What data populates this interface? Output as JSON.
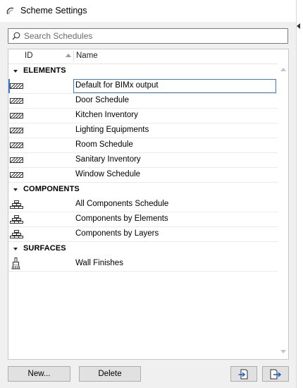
{
  "window": {
    "title": "Scheme Settings"
  },
  "search": {
    "placeholder": "Search Schedules"
  },
  "columns": {
    "id": "ID",
    "name": "Name"
  },
  "groups": [
    {
      "label": "ELEMENTS",
      "icon": "hatch-icon",
      "items": [
        {
          "id": "",
          "name": "Default for BIMx output",
          "selected": true
        },
        {
          "id": "",
          "name": "Door Schedule"
        },
        {
          "id": "",
          "name": "Kitchen Inventory"
        },
        {
          "id": "",
          "name": "Lighting Equipments"
        },
        {
          "id": "",
          "name": "Room Schedule"
        },
        {
          "id": "",
          "name": "Sanitary Inventory"
        },
        {
          "id": "",
          "name": "Window Schedule"
        }
      ]
    },
    {
      "label": "COMPONENTS",
      "icon": "bricks-icon",
      "items": [
        {
          "id": "",
          "name": "All Components Schedule"
        },
        {
          "id": "",
          "name": "Components by Elements"
        },
        {
          "id": "",
          "name": "Components by Layers"
        }
      ]
    },
    {
      "label": "SURFACES",
      "icon": "paint-brush-icon",
      "items": [
        {
          "id": "",
          "name": "Wall Finishes"
        }
      ]
    }
  ],
  "buttons": {
    "new": "New...",
    "delete": "Delete",
    "import": "import-icon",
    "export": "export-icon"
  },
  "colors": {
    "selection": "#3b7bd0",
    "background": "#f0f0f0"
  }
}
